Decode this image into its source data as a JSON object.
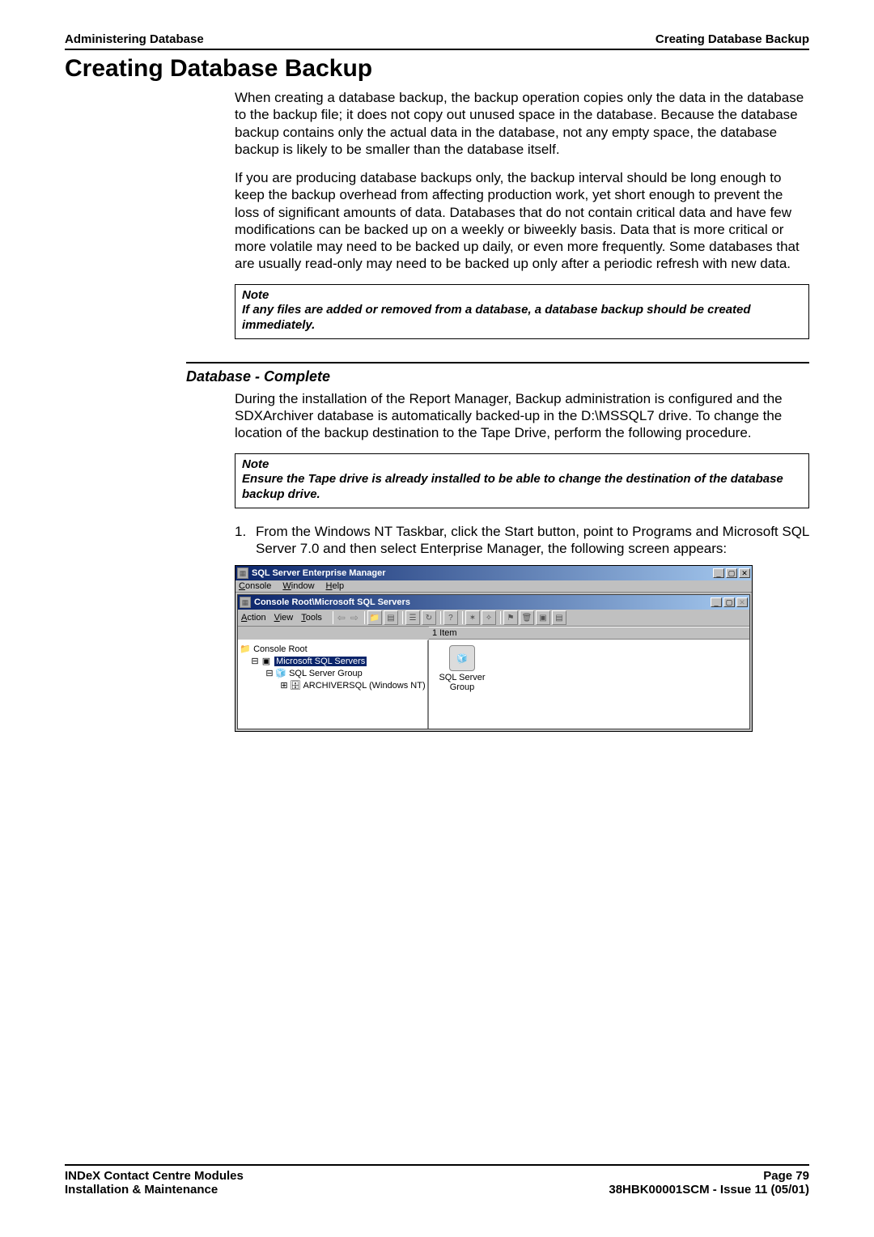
{
  "header": {
    "left": "Administering Database",
    "right": "Creating Database Backup"
  },
  "title": "Creating Database Backup",
  "intro_p1": "When creating a database backup, the backup operation copies only the data in the database to the backup file; it does not copy out unused space in the database. Because the database backup contains only the actual data in the database, not any empty space, the database backup is likely to be smaller than the database itself.",
  "intro_p2": "If you are producing database backups only, the backup interval should be long enough to keep the backup overhead from affecting production work, yet short enough to prevent the loss of significant amounts of data.  Databases that do not contain critical data and have few modifications can be backed up on a weekly or biweekly basis.  Data that is more critical or more volatile may need to be backed up daily, or even more frequently.  Some databases that are usually read-only may need to be backed up only after a periodic refresh with new data.",
  "note1_head": "Note",
  "note1_body": "If any files are added or removed from a database, a database backup should be created immediately.",
  "sub_heading": "Database - Complete",
  "sub_p1": "During the installation of the Report Manager, Backup administration is configured and the SDXArchiver database is automatically backed-up in the D:\\MSSQL7 drive. To change the location of the backup destination to the Tape Drive, perform the following procedure.",
  "note2_head": "Note",
  "note2_body": "Ensure the Tape drive is already installed to be able to change the destination of the database backup drive.",
  "step1_num": "1.",
  "step1_text": "From the Windows NT Taskbar, click the Start button, point to Programs and Microsoft SQL Server 7.0 and then select Enterprise Manager, the following screen appears:",
  "screenshot": {
    "outer_title": "SQL Server Enterprise Manager",
    "menubar": {
      "m1": "Console",
      "m2": "Window",
      "m3": "Help"
    },
    "inner_title": "Console Root\\Microsoft SQL Servers",
    "toolbar_menu": {
      "t1": "Action",
      "t2": "View",
      "t3": "Tools"
    },
    "count_text": "1 Item",
    "tree": {
      "n0": "Console Root",
      "n1": "Microsoft SQL Servers",
      "n2": "SQL Server Group",
      "n3": "ARCHIVERSQL (Windows NT)"
    },
    "content_label1": "SQL Server",
    "content_label2": "Group"
  },
  "footer": {
    "l1": "INDeX Contact Centre Modules",
    "l2": "Installation & Maintenance",
    "r1": "Page 79",
    "r2": "38HBK00001SCM - Issue 11 (05/01)"
  }
}
